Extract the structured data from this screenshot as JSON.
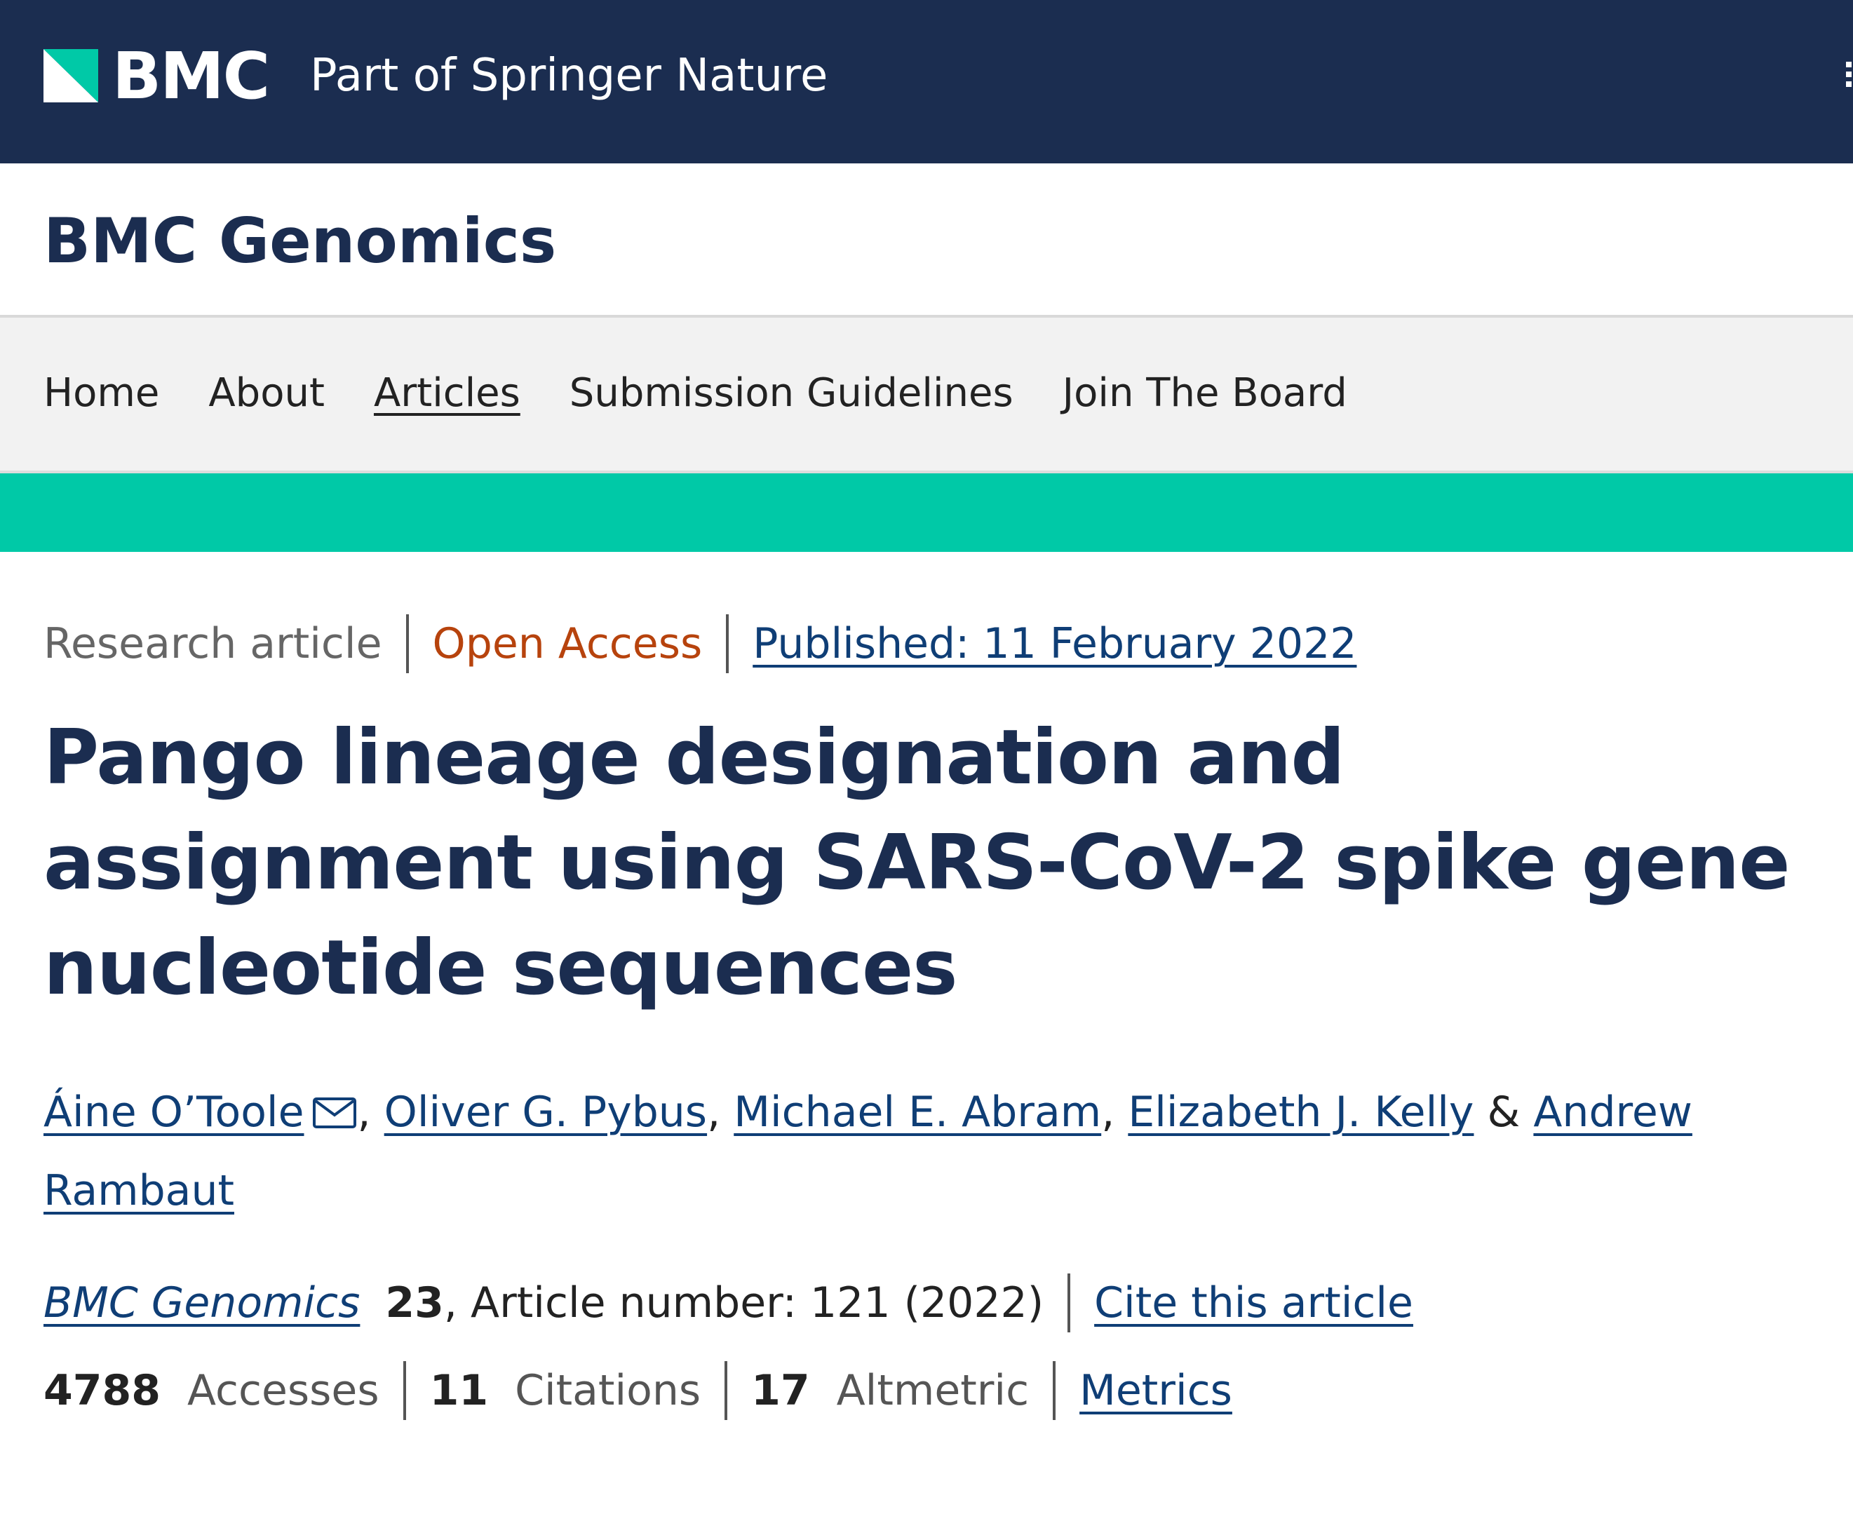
{
  "brand": {
    "logo_icon": "bmc-logo-mark",
    "name": "BMC",
    "tagline": "Part of Springer Nature",
    "colors": {
      "navy": "#1b2d50",
      "teal": "#00c9a7",
      "link": "#0f3e76",
      "open_access": "#b7430d"
    }
  },
  "journal": {
    "title": "BMC Genomics"
  },
  "nav": {
    "items": [
      {
        "label": "Home",
        "active": false
      },
      {
        "label": "About",
        "active": false
      },
      {
        "label": "Articles",
        "active": true
      },
      {
        "label": "Submission Guidelines",
        "active": false
      },
      {
        "label": "Join The Board",
        "active": false
      }
    ]
  },
  "article": {
    "type": "Research article",
    "access": "Open Access",
    "published": "Published: 11 February 2022",
    "title": "Pango lineage designation and assignment using SARS-CoV-2 spike gene nucleotide sequences",
    "authors": [
      {
        "name": "Áine O’Toole",
        "corresponding": true,
        "after": ", "
      },
      {
        "name": "Oliver G. Pybus",
        "after": ", "
      },
      {
        "name": "Michael E. Abram",
        "after": ", "
      },
      {
        "name": "Elizabeth J. Kelly",
        "after": " & "
      },
      {
        "name": "Andrew Rambaut",
        "after": ""
      }
    ],
    "citation": {
      "journal": "BMC Genomics",
      "volume": "23",
      "rest": ", Article number: 121 (2022)",
      "cite_link": "Cite this article"
    },
    "metrics": {
      "accesses_value": "4788",
      "accesses_label": "Accesses",
      "citations_value": "11",
      "citations_label": "Citations",
      "altmetric_value": "17",
      "altmetric_label": "Altmetric",
      "metrics_link": "Metrics"
    }
  }
}
